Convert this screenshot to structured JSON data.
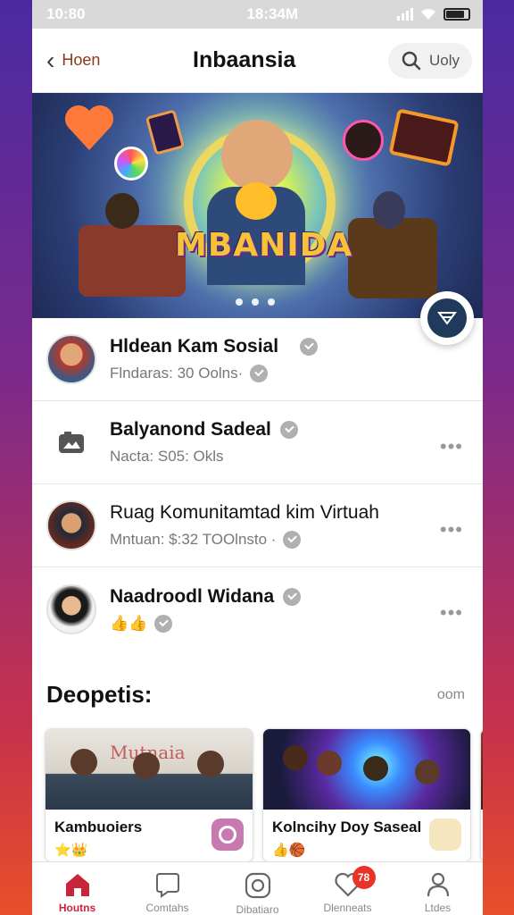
{
  "status_bar": {
    "time_left": "10:80",
    "time_center": "18:34M"
  },
  "header": {
    "back_label": "Hoen",
    "title": "Inbaansia",
    "search_label": "Uoly"
  },
  "hero": {
    "banner_text": "MBANIDA",
    "dots": 3
  },
  "list": [
    {
      "title": "Hldean Kam Sosial",
      "subtitle": "Flndaras: 30 Oolns·"
    },
    {
      "title": "Balyanond Sadeal",
      "subtitle": "Nacta: S05: Okls"
    },
    {
      "title": "Ruag Komunitamtad kim Virtuah",
      "subtitle": "Mntuan: $:32 TOOlnsto ·"
    },
    {
      "title": "Naadroodl Widana",
      "subtitle": "👍👍"
    }
  ],
  "section": {
    "title": "Deopetis:",
    "link": "oom"
  },
  "cards": [
    {
      "label": "Kambuoiers",
      "emoji": "⭐👑",
      "banner": "Mutnaia"
    },
    {
      "label": "Kolncihy Doy Saseal",
      "emoji": "👍🏀"
    }
  ],
  "tabbar": [
    {
      "label": "Houtns",
      "icon": "home-icon",
      "active": true
    },
    {
      "label": "Comtahs",
      "icon": "chat-icon"
    },
    {
      "label": "Dibatiaro",
      "icon": "camera-icon"
    },
    {
      "label": "Dlenneats",
      "icon": "heart-icon",
      "badge": "78"
    },
    {
      "label": "Ltdes",
      "icon": "profile-icon"
    }
  ],
  "colors": {
    "accent": "#c8243a",
    "fab": "#1f3a5a",
    "badge": "#e8322a"
  }
}
